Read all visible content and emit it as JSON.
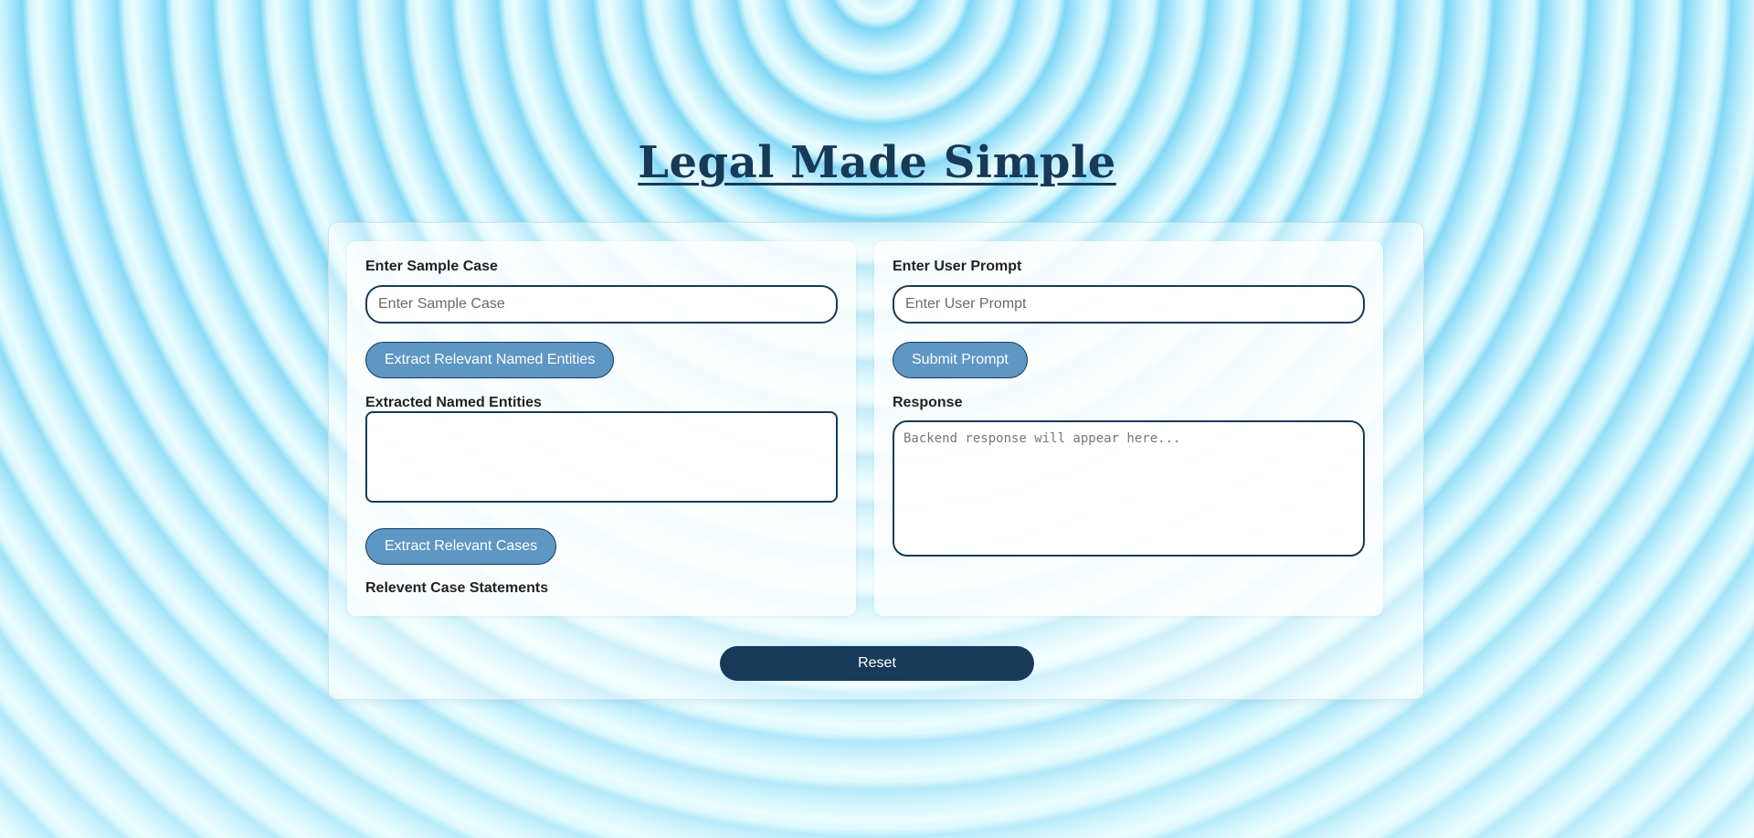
{
  "page": {
    "title": "Legal Made Simple"
  },
  "left_panel": {
    "sample_case_label": "Enter Sample Case",
    "sample_case_placeholder": "Enter Sample Case",
    "sample_case_value": "",
    "extract_entities_button": "Extract Relevant Named Entities",
    "entities_label": "Extracted Named Entities",
    "entities_value": "",
    "extract_cases_button": "Extract Relevant Cases",
    "case_statements_label": "Relevent Case Statements"
  },
  "right_panel": {
    "user_prompt_label": "Enter User Prompt",
    "user_prompt_placeholder": "Enter User Prompt",
    "user_prompt_value": "",
    "submit_button": "Submit Prompt",
    "response_label": "Response",
    "response_placeholder": "Backend response will appear here...",
    "response_value": ""
  },
  "footer": {
    "reset_button": "Reset"
  },
  "colors": {
    "primary_dark": "#173a59",
    "button_blue": "#5e96c4",
    "background_ring": "#7fd6f5"
  }
}
